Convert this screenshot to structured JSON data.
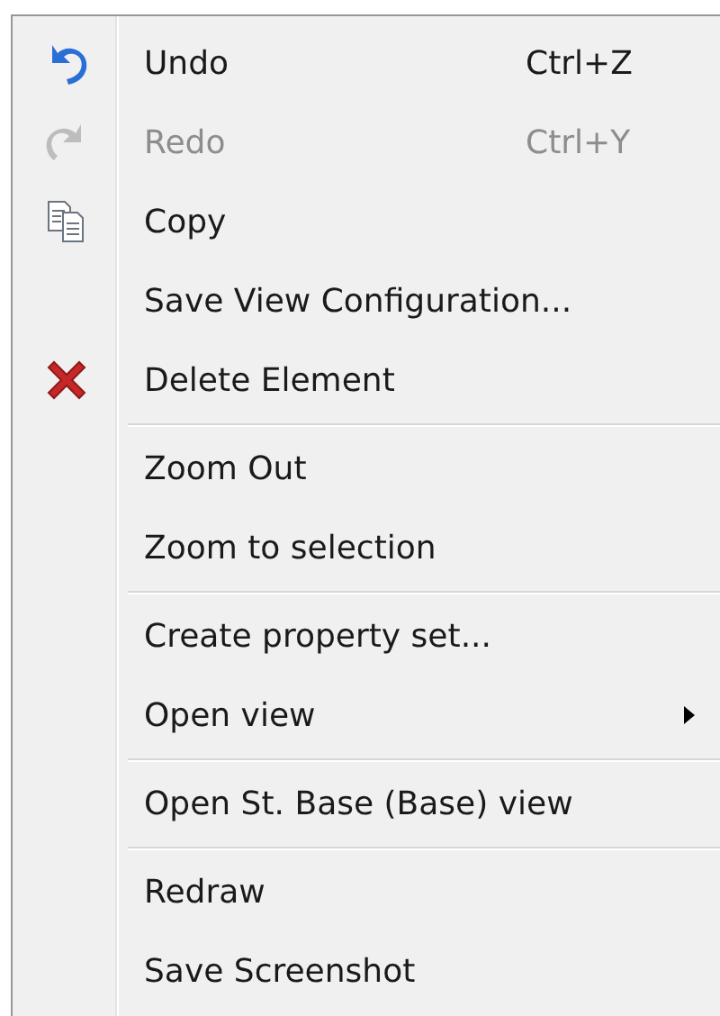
{
  "context_menu": {
    "sections": [
      {
        "items": [
          {
            "label": "Undo",
            "shortcut": "Ctrl+Z",
            "kind": "undo",
            "disabled": false
          },
          {
            "label": "Redo",
            "shortcut": "Ctrl+Y",
            "kind": "redo",
            "disabled": true
          },
          {
            "label": "Copy",
            "kind": "copy",
            "disabled": false
          },
          {
            "label": "Save View Configuration...",
            "disabled": false
          },
          {
            "label": "Delete Element",
            "kind": "delete",
            "disabled": false
          }
        ]
      },
      {
        "items": [
          {
            "label": "Zoom Out",
            "disabled": false
          },
          {
            "label": "Zoom to selection",
            "disabled": false
          }
        ]
      },
      {
        "items": [
          {
            "label": "Create property set...",
            "disabled": false
          },
          {
            "label": "Open view",
            "submenu": true,
            "disabled": false
          }
        ]
      },
      {
        "items": [
          {
            "label": "Open St. Base (Base) view",
            "disabled": false
          }
        ]
      },
      {
        "items": [
          {
            "label": "Redraw",
            "disabled": false
          },
          {
            "label": "Save Screenshot",
            "disabled": false
          }
        ]
      }
    ]
  }
}
